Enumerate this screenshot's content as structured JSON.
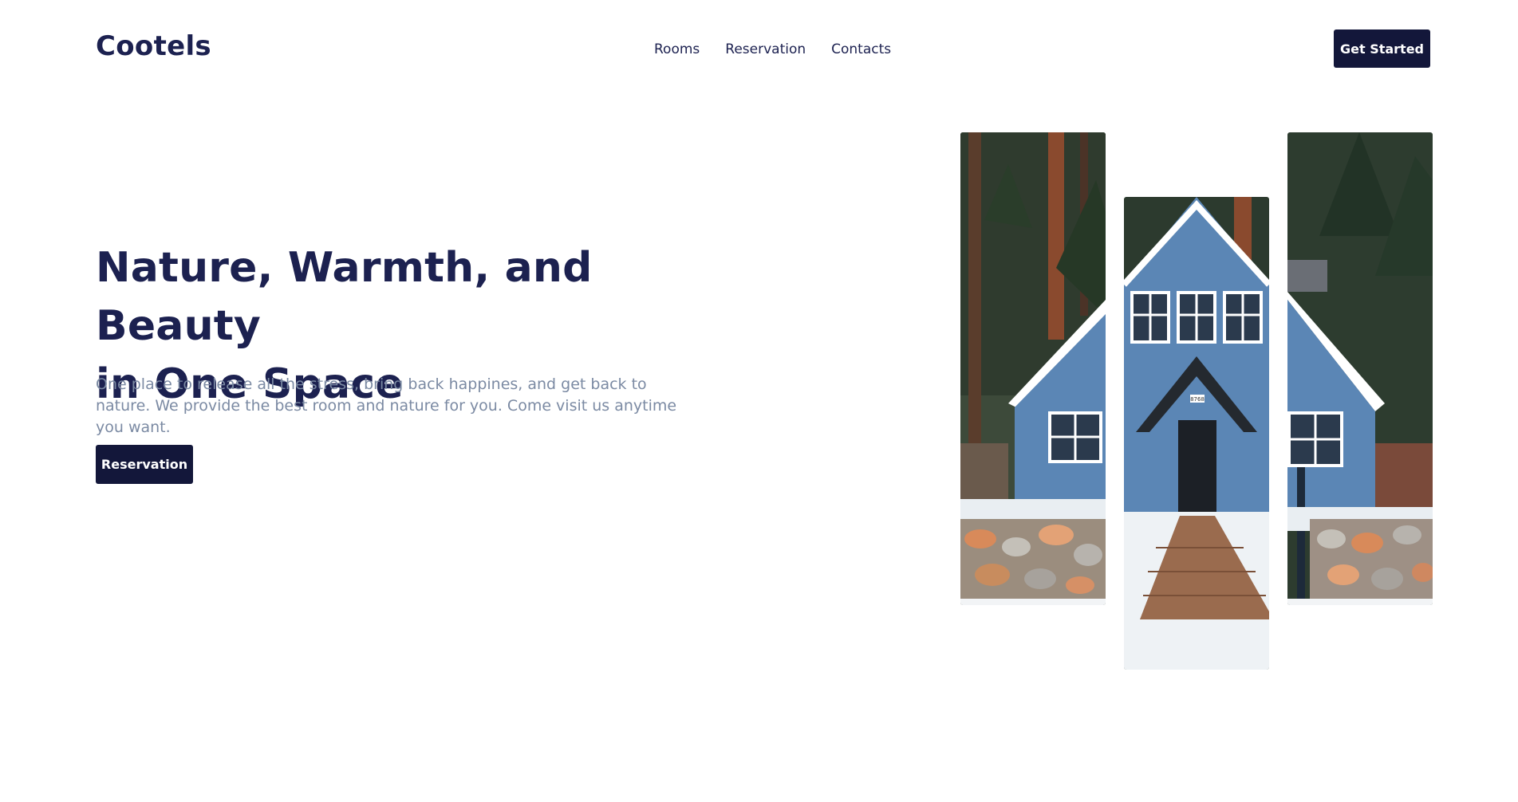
{
  "header": {
    "logo": "Cootels",
    "nav": [
      {
        "label": "Rooms"
      },
      {
        "label": "Reservation"
      },
      {
        "label": "Contacts"
      }
    ],
    "cta_label": "Get Started"
  },
  "hero": {
    "title_line1": "Nature, Warmth, and Beauty",
    "title_line2": "in One Space",
    "description": "One place to release all the stress, bring back happines, and get back to nature. We provide the best room and nature for you. Come visit us anytime you want.",
    "button_label": "Reservation"
  },
  "gallery": {
    "house_number": "8768"
  },
  "colors": {
    "brand_dark": "#13173a",
    "heading": "#1c2150",
    "muted_text": "#7b8aa3",
    "house_blue": "#5b86b5"
  }
}
